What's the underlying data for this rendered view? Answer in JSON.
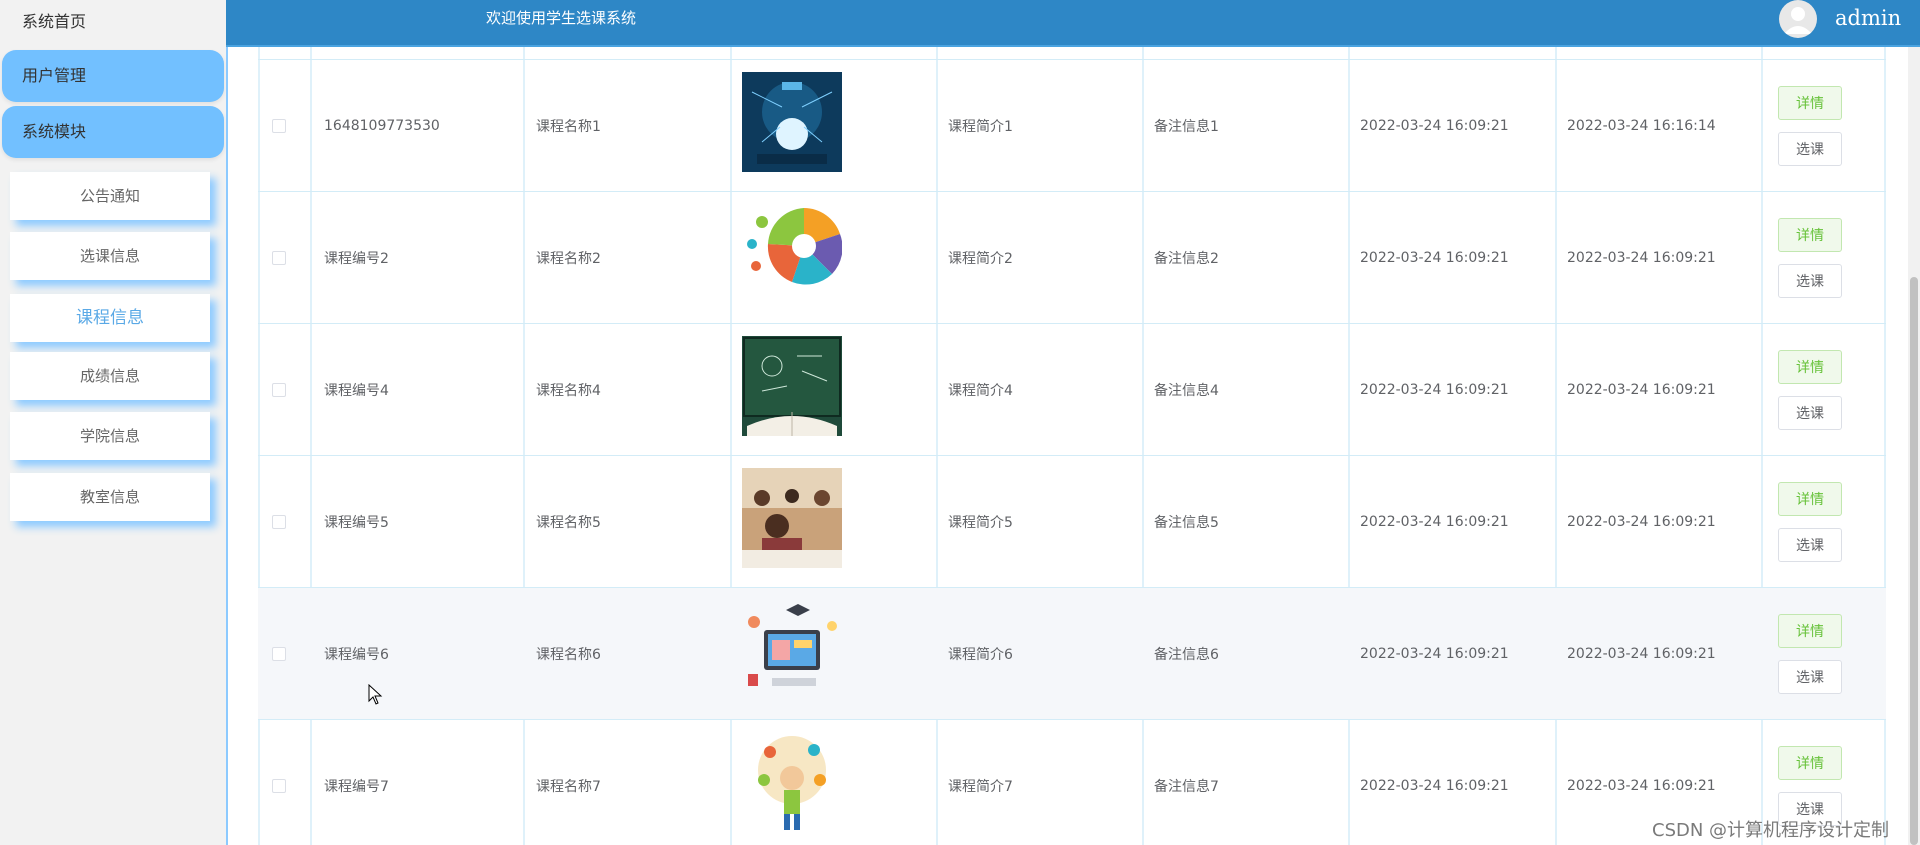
{
  "sidebar": {
    "home": "系统首页",
    "groups": [
      "用户管理",
      "系统模块"
    ],
    "items": [
      {
        "label": "公告通知",
        "active": false
      },
      {
        "label": "选课信息",
        "active": false
      },
      {
        "label": "课程信息",
        "active": true
      },
      {
        "label": "成绩信息",
        "active": false
      },
      {
        "label": "学院信息",
        "active": false
      },
      {
        "label": "教室信息",
        "active": false
      }
    ]
  },
  "header": {
    "welcome": "欢迎使用学生选课系统",
    "username": "admin",
    "avatar_icon": "user-avatar-icon"
  },
  "table": {
    "rows": [
      {
        "code": "1648109773530",
        "name": "课程名称1",
        "image": "lightbulb-tech-image",
        "intro": "课程简介1",
        "remark": "备注信息1",
        "created": "2022-03-24 16:09:21",
        "updated": "2022-03-24 16:16:14"
      },
      {
        "code": "课程编号2",
        "name": "课程名称2",
        "image": "pie-diagram-image",
        "intro": "课程简介2",
        "remark": "备注信息2",
        "created": "2022-03-24 16:09:21",
        "updated": "2022-03-24 16:09:21"
      },
      {
        "code": "课程编号4",
        "name": "课程名称4",
        "image": "chalkboard-book-image",
        "intro": "课程简介4",
        "remark": "备注信息4",
        "created": "2022-03-24 16:09:21",
        "updated": "2022-03-24 16:09:21"
      },
      {
        "code": "课程编号5",
        "name": "课程名称5",
        "image": "classroom-students-image",
        "intro": "课程简介5",
        "remark": "备注信息5",
        "created": "2022-03-24 16:09:21",
        "updated": "2022-03-24 16:09:21"
      },
      {
        "code": "课程编号6",
        "name": "课程名称6",
        "image": "online-learning-image",
        "intro": "课程简介6",
        "remark": "备注信息6",
        "created": "2022-03-24 16:09:21",
        "updated": "2022-03-24 16:09:21"
      },
      {
        "code": "课程编号7",
        "name": "课程名称7",
        "image": "thinking-boy-image",
        "intro": "课程简介7",
        "remark": "备注信息7",
        "created": "2022-03-24 16:09:21",
        "updated": "2022-03-24 16:09:21"
      }
    ],
    "detail_label": "详情",
    "select_label": "选课"
  },
  "colors": {
    "header": "#2e87c6",
    "sidebar_group": "#72c0ff",
    "active_item": "#5aa9e6",
    "detail_button": "#67c23a"
  },
  "watermark": "CSDN @计算机程序设计定制"
}
